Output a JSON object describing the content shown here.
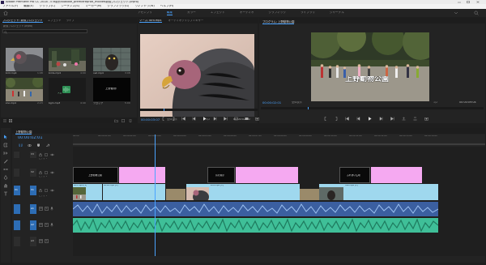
{
  "app": {
    "title": "Adobe Premiere Pro CC 2018 - E:¥制作¥Adobe_premierepro¥_movie¥新規プロジェクト.prproj"
  },
  "menu": [
    "ファイル(F)",
    "編集(E)",
    "クリップ(C)",
    "シーケンス(S)",
    "マーカー(M)",
    "グラフィック(G)",
    "ウィンドウ(W)",
    "ヘルプ(H)"
  ],
  "workspaces": [
    "アセンブリ",
    "編集",
    "カラー",
    "エフェクト",
    "オーディオ",
    "グラフィック",
    "ライブラリ",
    "ジャーナル"
  ],
  "project_panel": {
    "tabs": [
      "プロジェクト: 新規プロジェクト",
      "エフェクト",
      "ライブ"
    ],
    "path": "新規プロジェクト.prproj",
    "items": [
      {
        "name": "bird.mp4",
        "meta": "1:08"
      },
      {
        "name": "birds.mp4",
        "meta": "4:00"
      },
      {
        "name": "owl.mp4",
        "meta": "3:08"
      },
      {
        "name": "zoo.mp4",
        "meta": "2:23"
      },
      {
        "name": "bgm.mp3",
        "meta": "4:40"
      },
      {
        "name": "テロップ",
        "meta": "5:00"
      }
    ],
    "black_label": "上野動物",
    "green_label": "スロー",
    "bottom_tabs": [
      "ペイン",
      "情報",
      "マーカー"
    ]
  },
  "source_monitor": {
    "tabs": [
      "ソース: bird.mp4",
      "オーディオクリップミキサー"
    ],
    "timecode": "00:00:03:07",
    "fit": "全体表示",
    "resolution": "1/2",
    "duration": "00:00:02:10"
  },
  "program_monitor": {
    "tab": "プログラム: 上野動物公園",
    "timecode": "00:00:02:01",
    "fit": "全体表示",
    "resolution": "1/2",
    "duration": "00:00:09:04",
    "caption": "上野動物公園"
  },
  "timeline": {
    "tab": "上野動物公園",
    "timecode": "00:00:02:01",
    "ruler": [
      "00:00",
      "00:00:01:00",
      "00:00:02:00",
      "00:00:03:00",
      "00:00:04:00",
      "00:00:05:00",
      "00:00:06:00",
      "00:00:07:00",
      "00:00:08:00",
      "00:00:09:00",
      "00:00:10:00",
      "00:00:11:00",
      "00:00:12:00",
      "00:00:13:00",
      "00:00:14:00"
    ],
    "tracks": [
      {
        "id": "V3",
        "name": "ビデオ 3"
      },
      {
        "id": "V2",
        "name": "ビデオ 2"
      },
      {
        "id": "V1",
        "name": "ビデオ 1"
      },
      {
        "id": "A1",
        "name": "オーディオ 1"
      },
      {
        "id": "A2",
        "name": "オーディオ 2"
      },
      {
        "id": "A3",
        "name": "オーディオ 3"
      }
    ],
    "title_clips": [
      "上野動物公園",
      "鳥の展示",
      "ふれあい広場"
    ],
    "video_clips": [
      {
        "name": "bird.mp4 [V]"
      },
      {
        "name": "birds.mp4 [V]"
      },
      {
        "name": "zoo.mp4 [V]"
      },
      {
        "name": "owl.mp4 [V]"
      }
    ]
  },
  "colors": {
    "accent": "#2d8ceb",
    "title_clip": "#f5a9f1",
    "video_clip": "#9fd8ee",
    "audio1": "#3b5fa0",
    "audio2": "#3fbf98"
  }
}
